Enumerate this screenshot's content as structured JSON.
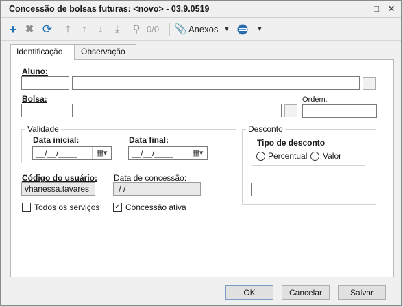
{
  "window": {
    "title": "Concessão de bolsas futuras: <novo> - 03.9.0519"
  },
  "toolbar": {
    "search_count": "0/0",
    "attachments_label": "Anexos"
  },
  "tabs": [
    {
      "label": "Identificação",
      "active": true
    },
    {
      "label": "Observação",
      "active": false
    }
  ],
  "form": {
    "aluno_label": "Aluno:",
    "aluno_code": "",
    "aluno_name": "",
    "lookup_button": "...",
    "bolsa_label": "Bolsa:",
    "bolsa_code": "",
    "bolsa_name": "",
    "ordem_label": "Ordem:",
    "ordem_value": "",
    "validade": {
      "legend": "Validade",
      "data_inicial_label": "Data inicial:",
      "data_inicial_value": "__/__/____",
      "data_final_label": "Data final:",
      "data_final_value": "__/__/____"
    },
    "desconto": {
      "legend": "Desconto",
      "tipo_legend": "Tipo de desconto",
      "percentual_label": "Percentual",
      "valor_label": "Valor",
      "valor_value": ""
    },
    "codigo_usuario_label": "Código do usuário:",
    "codigo_usuario_value": "vhanessa.tavares",
    "data_concessao_label": "Data de concessão:",
    "data_concessao_value": " / /",
    "todos_servicos_label": "Todos os serviços",
    "todos_servicos_checked": false,
    "concessao_ativa_label": "Concessão ativa",
    "concessao_ativa_checked": true
  },
  "buttons": {
    "ok": "OK",
    "cancel": "Cancelar",
    "save": "Salvar"
  }
}
